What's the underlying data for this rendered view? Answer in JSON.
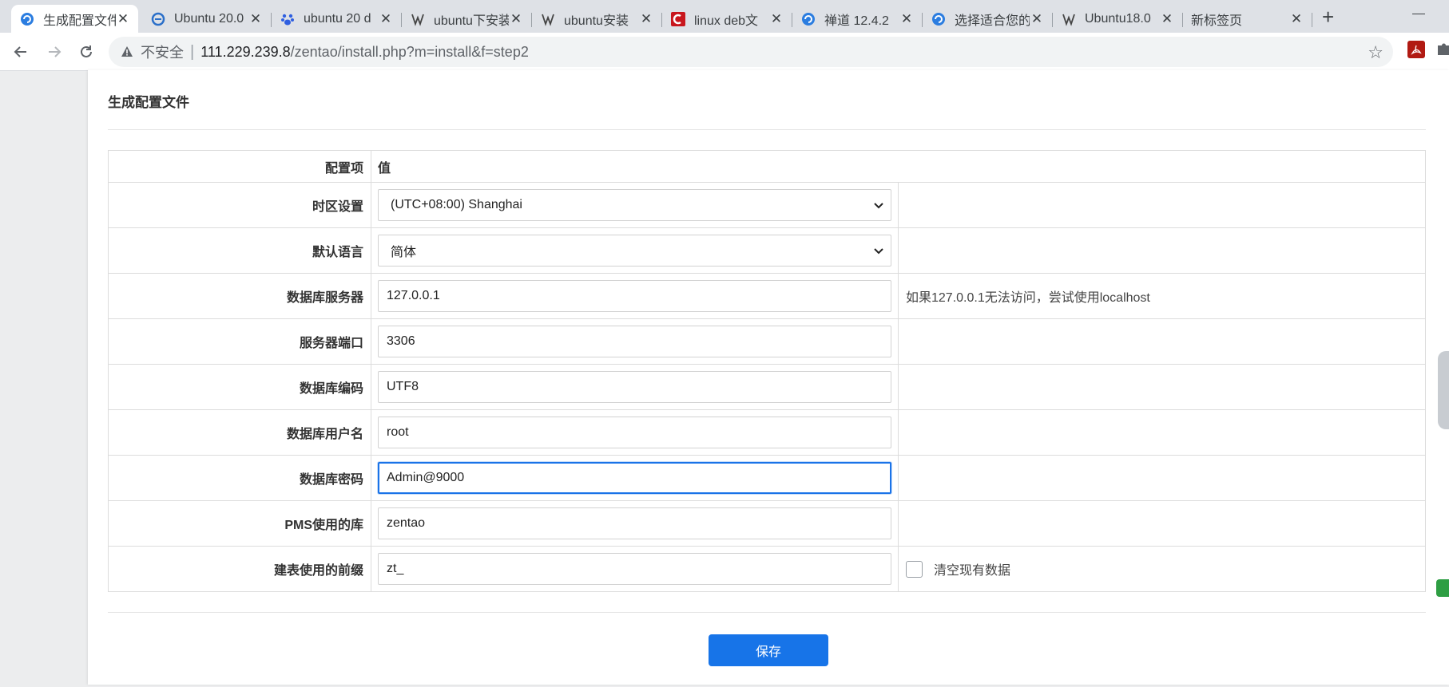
{
  "browser": {
    "tabs": [
      {
        "label": "生成配置文件",
        "icon": "zentao-icon",
        "active": true
      },
      {
        "label": "Ubuntu 20.0",
        "icon": "ie-icon"
      },
      {
        "label": "ubuntu 20 d",
        "icon": "baidu-paw-icon"
      },
      {
        "label": "ubuntu下安装",
        "icon": "wolf-icon"
      },
      {
        "label": "ubuntu安装",
        "icon": "wolf-icon"
      },
      {
        "label": "linux deb文",
        "icon": "csdn-icon"
      },
      {
        "label": "禅道 12.4.2",
        "icon": "zentao-icon"
      },
      {
        "label": "选择适合您的",
        "icon": "zentao-icon"
      },
      {
        "label": "Ubuntu18.0",
        "icon": "wolf-icon"
      },
      {
        "label": "新标签页",
        "icon": ""
      }
    ],
    "address": {
      "security_label": "不安全",
      "host": "111.229.239.8",
      "path": "/zentao/install.php?m=install&f=step2"
    }
  },
  "page": {
    "heading": "生成配置文件",
    "table": {
      "header_item": "配置项",
      "header_value": "值",
      "rows": [
        {
          "label": "时区设置",
          "value": "(UTC+08:00) Shanghai",
          "type": "select",
          "note": ""
        },
        {
          "label": "默认语言",
          "value": "简体",
          "type": "select",
          "note": ""
        },
        {
          "label": "数据库服务器",
          "value": "127.0.0.1",
          "type": "input",
          "note": "如果127.0.0.1无法访问，尝试使用localhost"
        },
        {
          "label": "服务器端口",
          "value": "3306",
          "type": "input",
          "note": ""
        },
        {
          "label": "数据库编码",
          "value": "UTF8",
          "type": "input",
          "note": ""
        },
        {
          "label": "数据库用户名",
          "value": "root",
          "type": "input",
          "note": ""
        },
        {
          "label": "数据库密码",
          "value": "Admin@9000",
          "type": "input",
          "note": "",
          "focused": true
        },
        {
          "label": "PMS使用的库",
          "value": "zentao",
          "type": "input",
          "note": ""
        },
        {
          "label": "建表使用的前缀",
          "value": "zt_",
          "type": "input",
          "note": ""
        }
      ],
      "clear_data_checkbox": {
        "label": "清空现有数据",
        "checked": false
      }
    },
    "save_label": "保存"
  },
  "colors": {
    "accent": "#1774e8",
    "focus_border": "#1a73e8",
    "csdn_red": "#c8161d",
    "zentao_blue": "#2b7de0"
  }
}
